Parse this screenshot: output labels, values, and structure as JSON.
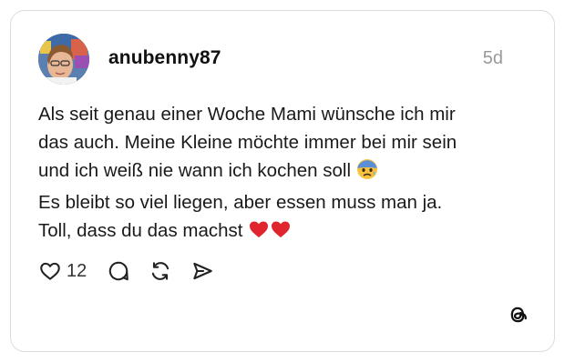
{
  "post": {
    "username": "anubenny87",
    "timestamp": "5d",
    "text_lines": [
      "Als seit genau einer Woche Mami wünsche ich mir",
      "das auch. Meine Kleine möchte immer bei mir sein",
      "und ich weiß nie wann ich kochen soll",
      "Es bleibt so viel liegen, aber essen muss man ja.",
      "Toll, dass du das machst"
    ],
    "emojis": {
      "line3": "anxious-face-with-sweat",
      "line5": [
        "red-heart",
        "red-heart"
      ]
    }
  },
  "actions": {
    "like_count": "12",
    "icons": [
      "heart-icon",
      "comment-icon",
      "repost-icon",
      "share-icon"
    ]
  },
  "branding": {
    "logo": "threads-logo-icon"
  },
  "colors": {
    "text": "#1a1a1a",
    "muted": "#999999",
    "border": "#dcdcdc",
    "heart_emoji": "#e0252f",
    "sweat_emoji": "#f9c23c"
  }
}
